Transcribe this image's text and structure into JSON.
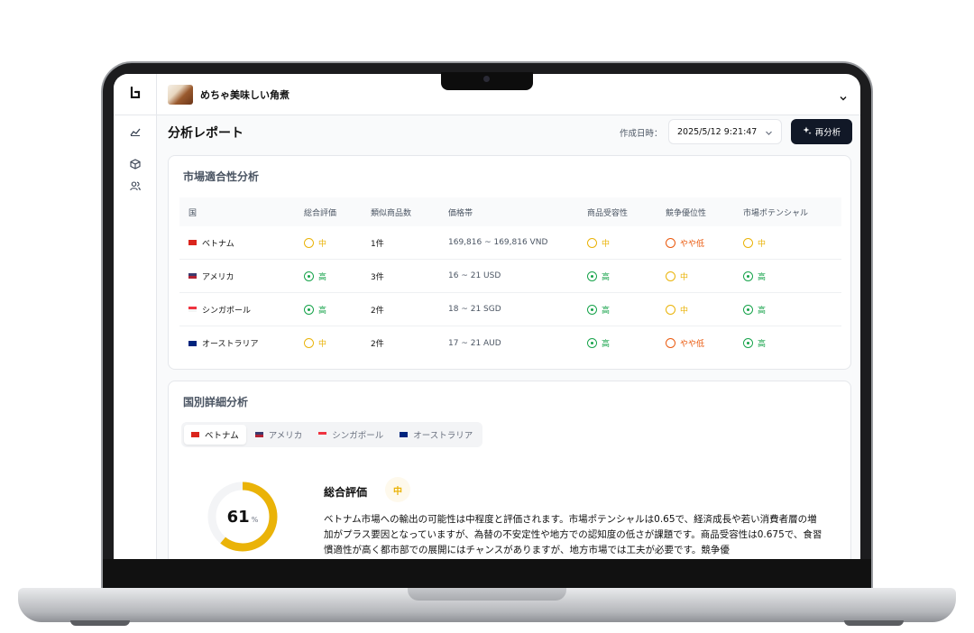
{
  "app": {
    "product_name": "めちゃ美味しい角煮"
  },
  "page": {
    "title": "分析レポート",
    "date_label": "作成日時：",
    "date_value": "2025/5/12 9:21:47",
    "reanalyze_label": "再分析"
  },
  "market_fit": {
    "title": "市場適合性分析",
    "headers": [
      "国",
      "総合評価",
      "類似商品数",
      "価格帯",
      "商品受容性",
      "競争優位性",
      "市場ポテンシャル"
    ],
    "rows": [
      {
        "country": "ベトナム",
        "flag": "vn",
        "overall": "中",
        "similar": "1件",
        "price": "169,816 ~ 169,816 VND",
        "acceptance": "中",
        "competition": "やや低",
        "potential": "中"
      },
      {
        "country": "アメリカ",
        "flag": "us",
        "overall": "高",
        "similar": "3件",
        "price": "16 ~ 21 USD",
        "acceptance": "高",
        "competition": "中",
        "potential": "高"
      },
      {
        "country": "シンガポール",
        "flag": "sg",
        "overall": "高",
        "similar": "2件",
        "price": "18 ~ 21 SGD",
        "acceptance": "高",
        "competition": "中",
        "potential": "高"
      },
      {
        "country": "オーストラリア",
        "flag": "au",
        "overall": "中",
        "similar": "2件",
        "price": "17 ~ 21 AUD",
        "acceptance": "高",
        "competition": "やや低",
        "potential": "高"
      }
    ]
  },
  "country_detail": {
    "title": "国別詳細分析",
    "tabs": [
      "ベトナム",
      "アメリカ",
      "シンガポール",
      "オーストラリア"
    ],
    "active_tab": 0,
    "score": 61,
    "score_unit": "%",
    "overall_label": "総合評価",
    "overall_value": "中",
    "summary": "ベトナム市場への輸出の可能性は中程度と評価されます。市場ポテンシャルは0.65で、経済成長や若い消費者層の増加がプラス要因となっていますが、為替の不安定性や地方での認知度の低さが課題です。商品受容性は0.675で、食習慣適性が高く都市部での展開にはチャンスがありますが、地方市場では工夫が必要です。競争優"
  },
  "colors": {
    "mid": "#eab308",
    "high": "#16a34a",
    "low": "#ea580c",
    "donut": "#eab308"
  }
}
